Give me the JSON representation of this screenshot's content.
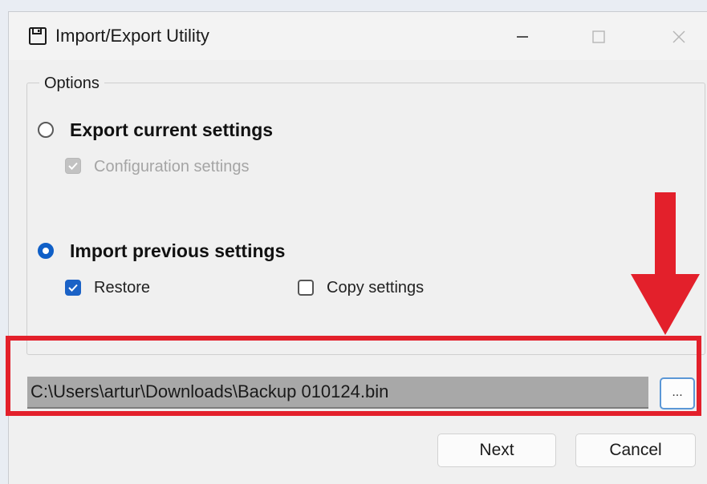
{
  "window": {
    "title": "Import/Export Utility"
  },
  "options": {
    "legend": "Options",
    "export": {
      "label": "Export current settings",
      "selected": false,
      "configuration": {
        "label": "Configuration settings",
        "checked": true,
        "enabled": false
      }
    },
    "import": {
      "label": "Import previous settings",
      "selected": true,
      "restore": {
        "label": "Restore",
        "checked": true
      },
      "copy_settings": {
        "label": "Copy settings",
        "checked": false
      }
    }
  },
  "file": {
    "path": "C:\\Users\\artur\\Downloads\\Backup 010124.bin",
    "browse_label": "..."
  },
  "buttons": {
    "next": "Next",
    "cancel": "Cancel"
  },
  "colors": {
    "accent": "#1b62c6",
    "highlight": "#e3202b"
  },
  "icons": {
    "app": "floppy-disk-icon",
    "minimize": "minimize-icon",
    "maximize": "maximize-icon",
    "close": "close-icon",
    "callout": "arrow-down-icon"
  }
}
